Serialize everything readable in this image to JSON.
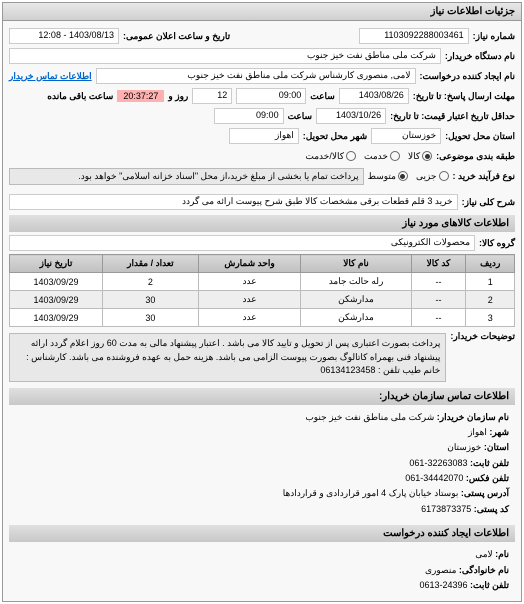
{
  "panel_title": "جزئیات اطلاعات نیاز",
  "request_no_label": "شماره نیاز:",
  "request_no": "1103092288003461",
  "public_datetime_label": "تاریخ و ساعت اعلان عمومی:",
  "public_datetime": "1403/08/13 - 12:08",
  "buyer_org_label": "نام دستگاه خریدار:",
  "buyer_org": "شرکت ملی مناطق نفت خیز جنوب",
  "requester_label": "نام ایجاد کننده درخواست:",
  "requester": "لامی, منصوری کارشناس شرکت ملی مناطق نفت خیز جنوب",
  "buyer_contact_label": "اطلاعات تماس خریدار",
  "deadline_label": "مهلت ارسال پاسخ: تا تاریخ:",
  "deadline_date": "1403/08/26",
  "time_label": "ساعت",
  "deadline_time": "09:00",
  "days_label": "روز و",
  "days_remain": "12",
  "countdown": "20:37:27",
  "remain_label": "ساعت باقی مانده",
  "validity_label": "حداقل تاریخ اعتبار قیمت: تا تاریخ:",
  "validity_date": "1403/10/26",
  "validity_time": "09:00",
  "province_label": "استان محل تحویل:",
  "province": "خوزستان",
  "city_label": "شهر محل تحویل:",
  "city": "اهواز",
  "category_label": "طبقه بندی موضوعی:",
  "cat_goods": "کالا",
  "cat_service": "خدمت",
  "cat_goods_service": "کالا/خدمت",
  "process_label": "نوع فرآیند خرید :",
  "proc_small": "جزیی",
  "proc_medium": "متوسط",
  "process_note": "پرداخت تمام یا بخشی از مبلغ خرید،از محل \"اسناد خزانه اسلامی\" خواهد بود.",
  "need_desc_label": "شرح کلی نیاز:",
  "need_desc": "خرید 3 قلم قطعات برقی مشخصات کالا طبق شرح پیوست ارائه می گردد",
  "goods_section": "اطلاعات کالاهای مورد نیاز",
  "goods_group_label": "گروه کالا:",
  "goods_group": "محصولات الکترونیکی",
  "table": {
    "headers": [
      "ردیف",
      "کد کالا",
      "نام کالا",
      "واحد شمارش",
      "تعداد / مقدار",
      "تاریخ نیاز"
    ],
    "rows": [
      [
        "1",
        "--",
        "رله حالت جامد",
        "عدد",
        "2",
        "1403/09/29"
      ],
      [
        "2",
        "--",
        "مدارشکن",
        "عدد",
        "30",
        "1403/09/29"
      ],
      [
        "3",
        "--",
        "مدارشکن",
        "عدد",
        "30",
        "1403/09/29"
      ]
    ]
  },
  "buyer_notes_label": "توضیحات خریدار:",
  "buyer_notes": "پرداخت بصورت اعتباری پس از تحویل و تایید کالا می باشد . اعتبار پیشنهاد مالی به مدت 60 روز اعلام گردد ارائه پیشنهاد فنی بهمراه کاتالوگ بصورت پیوست الزامی می باشد. هزینه حمل به عهده فروشنده می باشد. کارشناس : خانم طیب تلفن : 06134123458",
  "contact_title": "اطلاعات تماس سازمان خریدار:",
  "c_org_label": "نام سازمان خریدار:",
  "c_org": "شرکت ملی مناطق نفت خیز جنوب",
  "c_city_label": "شهر:",
  "c_city": "اهواز",
  "c_province_label": "استان:",
  "c_province": "خوزستان",
  "c_phone_label": "تلفن ثابت:",
  "c_phone": "32263083-061",
  "c_fax_label": "تلفن فکس:",
  "c_fax": "34442070-061",
  "c_address_label": "آدرس پستی:",
  "c_address": "بوستاد خیابان پارک 4 امور قراردادی و قراردادها",
  "c_postal_label": "کد پستی:",
  "c_postal": "6173873375",
  "creator_title": "اطلاعات ایجاد کننده درخواست",
  "cr_name_label": "نام:",
  "cr_name": "لامی",
  "cr_family_label": "نام خانوادگی:",
  "cr_family": "منصوری",
  "cr_phone_label": "تلفن ثابت:",
  "cr_phone": "24396-0613"
}
